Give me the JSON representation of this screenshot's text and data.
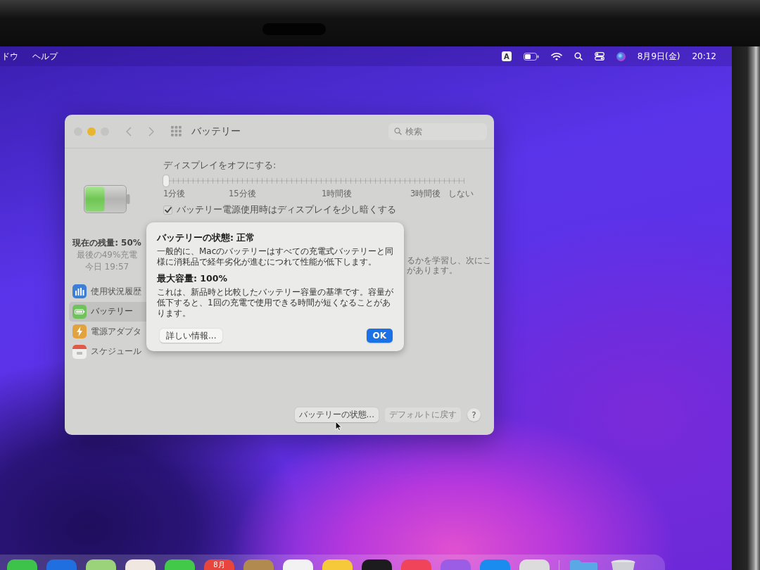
{
  "menu_bar": {
    "menus": [
      "ドウ",
      "ヘルプ"
    ],
    "input_source": "A",
    "date": "8月9日(金)",
    "time": "20:12"
  },
  "window": {
    "title": "バッテリー",
    "search": {
      "placeholder": "検索"
    }
  },
  "sidebar": {
    "status": {
      "charge": "現在の残量: 50%",
      "last_charged": "最後の49%充電",
      "last_charged_time": "今日 19:57"
    },
    "items": [
      {
        "label": "使用状況履歴",
        "kind": "chart",
        "selected": false
      },
      {
        "label": "バッテリー",
        "kind": "battery",
        "selected": true
      },
      {
        "label": "電源アダプタ",
        "kind": "power",
        "selected": false
      },
      {
        "label": "スケジュール",
        "kind": "calendar",
        "selected": false
      }
    ]
  },
  "main": {
    "display_off": {
      "label": "ディスプレイをオフにする:",
      "level": 0,
      "tick_labels": [
        "1分後",
        "15分後",
        "1時間後",
        "3時間後",
        "しない"
      ]
    },
    "dim_display": {
      "label": "バッテリー電源使用時はディスプレイを少し暗くする",
      "checked": true
    },
    "covered_text": [
      "るかを学習し、次にこ",
      "があります。"
    ],
    "buttons": [
      {
        "label": "バッテリーの状態...",
        "disabled": false
      },
      {
        "label": "デフォルトに戻す",
        "disabled": true
      }
    ],
    "help": "?"
  },
  "dialog": {
    "title": "バッテリーの状態: 正常",
    "body": "一般的に、Macのバッテリーはすべての充電式バッテリーと同様に消耗品で経年劣化が進むにつれて性能が低下します。",
    "subtitle": "最大容量: 100%",
    "note": "これは、新品時と比較したバッテリー容量の基準です。容量が低下すると、1回の充電で使用できる時間が短くなることがあります。",
    "buttons": [
      {
        "label": "詳しい情報...",
        "default": false
      },
      {
        "label": "OK",
        "default": true
      }
    ]
  },
  "dock": {
    "items": [
      {
        "kind": "app",
        "color": "#3dc34a"
      },
      {
        "kind": "app",
        "color": "#1f6fe0"
      },
      {
        "kind": "app",
        "color": "#9bd37a"
      },
      {
        "kind": "app",
        "color": "#f0e8e0"
      },
      {
        "kind": "app",
        "color": "#42c94a"
      },
      {
        "kind": "calendar",
        "label": "8月"
      },
      {
        "kind": "app",
        "color": "#b08a4f"
      },
      {
        "kind": "app",
        "color": "#f2f2f2"
      },
      {
        "kind": "app",
        "color": "#f5c93a"
      },
      {
        "kind": "app",
        "color": "#1c1c1e"
      },
      {
        "kind": "app",
        "color": "#f0445a"
      },
      {
        "kind": "app",
        "color": "#9b5de5"
      },
      {
        "kind": "app",
        "color": "#1a8cf0"
      },
      {
        "kind": "app",
        "color": "#dcdcdc"
      },
      {
        "kind": "divider"
      },
      {
        "kind": "folder"
      },
      {
        "kind": "trash"
      }
    ]
  }
}
